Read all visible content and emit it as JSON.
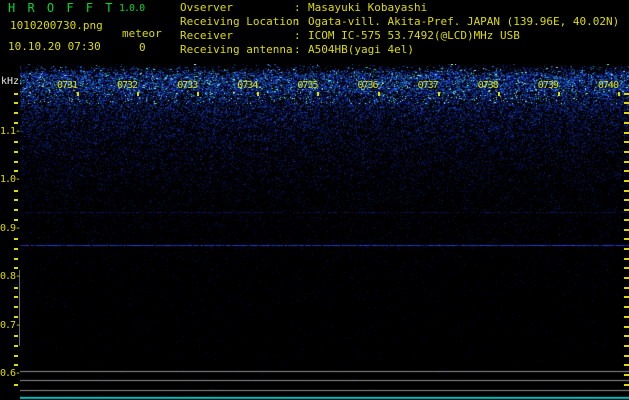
{
  "header": {
    "app_title": "H R O F F T",
    "version": "1.0.0",
    "filename": "1010200730.png",
    "mode_label": "meteor",
    "event_count": "0",
    "datetime": "10.10.20 07:30"
  },
  "info_panel": {
    "separator": ":",
    "rows": [
      {
        "label": "Ovserver",
        "value": "Masayuki Kobayashi"
      },
      {
        "label": "Receiving Location",
        "value": "Ogata-vill. Akita-Pref. JAPAN (139.96E, 40.02N)"
      },
      {
        "label": "Receiver",
        "value": "ICOM IC-575 53.7492(@LCD)MHz USB"
      },
      {
        "label": "Receiving antenna",
        "value": "A504HB(yagi 4el)"
      }
    ]
  },
  "spectrogram": {
    "unit_label": "kHz",
    "tick_dash": "-",
    "freq_labels": [
      "1.1",
      "1.0",
      "0.9",
      "0.8",
      "0.7",
      "0.6"
    ],
    "time_labels": [
      "0731",
      "0732",
      "0733",
      "0734",
      "0735",
      "0736",
      "0737",
      "0738",
      "0739",
      "0740"
    ],
    "colors": {
      "title_green": "#00d830",
      "text_yellow": "#dcdc00",
      "unit_white": "#e8e8e8",
      "noise_blue": "#0033cc",
      "carrier_blue": "#2a3ac0",
      "grid_gray": "#8c8c8c",
      "baseline_cyan": "#00dcdc",
      "background": "#000000"
    }
  }
}
